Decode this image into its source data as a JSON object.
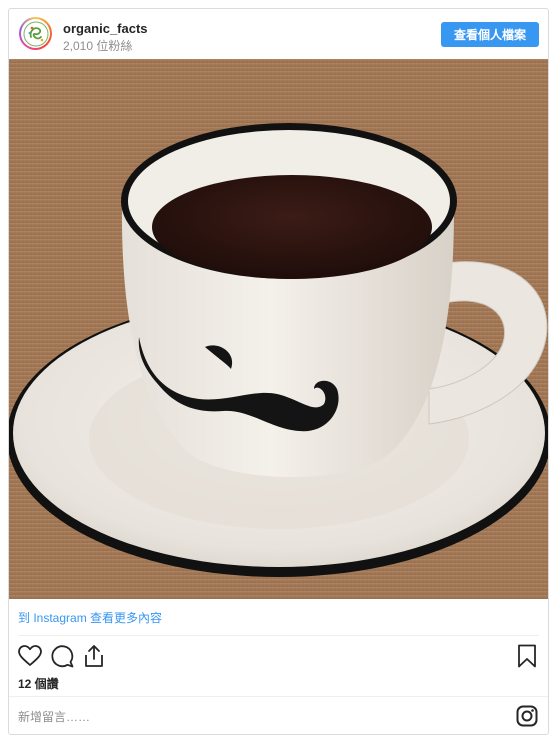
{
  "header": {
    "username": "organic_facts",
    "followers": "2,010 位粉絲",
    "profile_button": "查看個人檔案"
  },
  "post": {
    "image_icon": "coffee-cup-mustache-photo",
    "instagram_link": "到 Instagram 查看更多內容",
    "likes": "12 個讚"
  },
  "actions": {
    "like_icon": "heart-icon",
    "comment_icon": "comment-icon",
    "share_icon": "share-icon",
    "save_icon": "bookmark-icon"
  },
  "comment": {
    "placeholder": "新增留言……"
  },
  "colors": {
    "link": "#3897f0",
    "button_bg": "#3897f0",
    "muted_text": "#8e8e8e",
    "border": "#dbdbdb"
  }
}
